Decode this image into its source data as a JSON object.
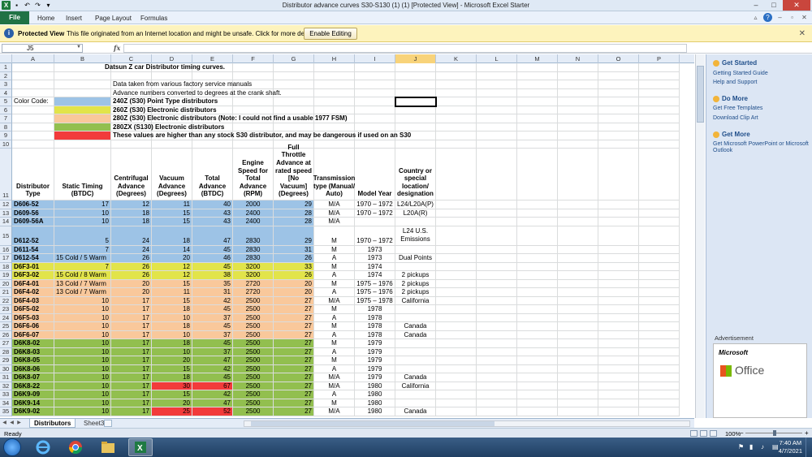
{
  "window": {
    "title": "Distributor advance curves S30-S130 (1) (1)  [Protected View] - Microsoft Excel Starter"
  },
  "ribbon": {
    "tabs": [
      "File",
      "Home",
      "Insert",
      "Page Layout",
      "Formulas"
    ]
  },
  "protected_view": {
    "label": "Protected View",
    "message": "This file originated from an Internet location and might be unsafe. Click for more details.",
    "button": "Enable Editing"
  },
  "formula_bar": {
    "name_box": "J5",
    "fx": "fx",
    "value": ""
  },
  "columns": [
    "A",
    "B",
    "C",
    "D",
    "E",
    "F",
    "G",
    "H",
    "I",
    "J",
    "K",
    "L",
    "M",
    "N",
    "O",
    "P"
  ],
  "selected_column": "J",
  "colors": {
    "blue": "#9dc3e6",
    "yellow": "#e2e44a",
    "peach": "#f9c89b",
    "green": "#92bf4f",
    "red": "#f23b3b"
  },
  "sheet": {
    "title": "Datsun Z car Distributor timing curves.",
    "note1": "Data taken from various factory service manuals",
    "note2": "Advance numbers converted to degrees at the crank shaft.",
    "color_code_label": "Color Code:",
    "legend": [
      {
        "color": "blue",
        "text": "240Z (S30) Point Type distributors"
      },
      {
        "color": "yellow",
        "text": "260Z (S30) Electronic distributors"
      },
      {
        "color": "peach",
        "text": "280Z (S30) Electronic distributors (Note: I could not find a usable 1977 FSM)"
      },
      {
        "color": "green",
        "text": "280ZX (S130) Electronic distributors"
      },
      {
        "color": "red",
        "text": "These values are higher than any stock S30 distributor, and may be dangerous if used on an S30"
      }
    ],
    "headers": [
      "Distributor Type",
      "Static Timing (BTDC)",
      "Centrifugal Advance (Degrees)",
      "Vacuum Advance (Degrees)",
      "Total Advance (BTDC)",
      "Engine Speed for Total Advance (RPM)",
      "Full Throttle Advance at rated speed [No Vacuum](Degrees)",
      "Transmission type (Manual/ Auto)",
      "Model Year",
      "Country or special location/ designation"
    ],
    "rows": [
      {
        "n": "12",
        "c": "blue",
        "a": "D606-52",
        "b": "17",
        "cc": "12",
        "d": "11",
        "e": "40",
        "f": "2000",
        "g": "29",
        "h": "M/A",
        "i": "1970 – 1972",
        "j": "L24/L20A(P)"
      },
      {
        "n": "13",
        "c": "blue",
        "a": "D609-56",
        "b": "10",
        "cc": "18",
        "d": "15",
        "e": "43",
        "f": "2400",
        "g": "28",
        "h": "M/A",
        "i": "1970 – 1972",
        "j": "L20A(R)"
      },
      {
        "n": "14",
        "c": "blue",
        "a": "D609-56A",
        "b": "10",
        "cc": "18",
        "d": "15",
        "e": "43",
        "f": "2400",
        "g": "28",
        "h": "M/A",
        "i": "",
        "j": ""
      },
      {
        "n": "15",
        "c": "blue",
        "a": "D612-52",
        "b": "5",
        "cc": "24",
        "d": "18",
        "e": "47",
        "f": "2830",
        "g": "29",
        "h": "M",
        "i": "1970 – 1972",
        "j": "L24 U.S. Emissions"
      },
      {
        "n": "16",
        "c": "blue",
        "a": "D611-54",
        "b": "7",
        "cc": "24",
        "d": "14",
        "e": "45",
        "f": "2830",
        "g": "31",
        "h": "M",
        "i": "1973",
        "j": ""
      },
      {
        "n": "17",
        "c": "blue",
        "a": "D612-54",
        "b": "15 Cold / 5 Warm",
        "cc": "26",
        "d": "20",
        "e": "46",
        "f": "2830",
        "g": "26",
        "h": "A",
        "i": "1973",
        "j": "Dual Points"
      },
      {
        "n": "18",
        "c": "yellow",
        "a": "D6F3-01",
        "b": "7",
        "cc": "26",
        "d": "12",
        "e": "45",
        "f": "3200",
        "g": "33",
        "h": "M",
        "i": "1974",
        "j": ""
      },
      {
        "n": "19",
        "c": "yellow",
        "a": "D6F3-02",
        "b": "15 Cold / 8 Warm",
        "cc": "26",
        "d": "12",
        "e": "38",
        "f": "3200",
        "g": "26",
        "h": "A",
        "i": "1974",
        "j": "2 pickups"
      },
      {
        "n": "20",
        "c": "peach",
        "a": "D6F4-01",
        "b": "13 Cold / 7 Warm",
        "cc": "20",
        "d": "15",
        "e": "35",
        "f": "2720",
        "g": "20",
        "h": "M",
        "i": "1975 – 1976",
        "j": "2 pickups"
      },
      {
        "n": "21",
        "c": "peach",
        "a": "D6F4-02",
        "b": "13 Cold / 7 Warm",
        "cc": "20",
        "d": "11",
        "e": "31",
        "f": "2720",
        "g": "20",
        "h": "A",
        "i": "1975 – 1976",
        "j": "2 pickups"
      },
      {
        "n": "22",
        "c": "peach",
        "a": "D6F4-03",
        "b": "10",
        "cc": "17",
        "d": "15",
        "e": "42",
        "f": "2500",
        "g": "27",
        "h": "M/A",
        "i": "1975 – 1978",
        "j": "California"
      },
      {
        "n": "23",
        "c": "peach",
        "a": "D6F5-02",
        "b": "10",
        "cc": "17",
        "d": "18",
        "e": "45",
        "f": "2500",
        "g": "27",
        "h": "M",
        "i": "1978",
        "j": ""
      },
      {
        "n": "24",
        "c": "peach",
        "a": "D6F5-03",
        "b": "10",
        "cc": "17",
        "d": "10",
        "e": "37",
        "f": "2500",
        "g": "27",
        "h": "A",
        "i": "1978",
        "j": ""
      },
      {
        "n": "25",
        "c": "peach",
        "a": "D6F6-06",
        "b": "10",
        "cc": "17",
        "d": "18",
        "e": "45",
        "f": "2500",
        "g": "27",
        "h": "M",
        "i": "1978",
        "j": "Canada"
      },
      {
        "n": "26",
        "c": "peach",
        "a": "D6F6-07",
        "b": "10",
        "cc": "17",
        "d": "10",
        "e": "37",
        "f": "2500",
        "g": "27",
        "h": "A",
        "i": "1978",
        "j": "Canada"
      },
      {
        "n": "27",
        "c": "green",
        "a": "D6K8-02",
        "b": "10",
        "cc": "17",
        "d": "18",
        "e": "45",
        "f": "2500",
        "g": "27",
        "h": "M",
        "i": "1979",
        "j": ""
      },
      {
        "n": "28",
        "c": "green",
        "a": "D6K8-03",
        "b": "10",
        "cc": "17",
        "d": "10",
        "e": "37",
        "f": "2500",
        "g": "27",
        "h": "A",
        "i": "1979",
        "j": ""
      },
      {
        "n": "29",
        "c": "green",
        "a": "D6K8-05",
        "b": "10",
        "cc": "17",
        "d": "20",
        "e": "47",
        "f": "2500",
        "g": "27",
        "h": "M",
        "i": "1979",
        "j": ""
      },
      {
        "n": "30",
        "c": "green",
        "a": "D6K8-06",
        "b": "10",
        "cc": "17",
        "d": "15",
        "e": "42",
        "f": "2500",
        "g": "27",
        "h": "A",
        "i": "1979",
        "j": ""
      },
      {
        "n": "31",
        "c": "green",
        "a": "D6K8-07",
        "b": "10",
        "cc": "17",
        "d": "18",
        "e": "45",
        "f": "2500",
        "g": "27",
        "h": "M/A",
        "i": "1979",
        "j": "Canada"
      },
      {
        "n": "32",
        "c": "green",
        "a": "D6K8-22",
        "b": "10",
        "cc": "17",
        "d": "30",
        "e": "67",
        "f": "2500",
        "g": "27",
        "h": "M/A",
        "i": "1980",
        "j": "California",
        "red": true
      },
      {
        "n": "33",
        "c": "green",
        "a": "D6K9-09",
        "b": "10",
        "cc": "17",
        "d": "15",
        "e": "42",
        "f": "2500",
        "g": "27",
        "h": "A",
        "i": "1980",
        "j": ""
      },
      {
        "n": "34",
        "c": "green",
        "a": "D6K9-14",
        "b": "10",
        "cc": "17",
        "d": "20",
        "e": "47",
        "f": "2500",
        "g": "27",
        "h": "M",
        "i": "1980",
        "j": ""
      },
      {
        "n": "35",
        "c": "green",
        "a": "D6K9-02",
        "b": "10",
        "cc": "17",
        "d": "25",
        "e": "52",
        "f": "2500",
        "g": "27",
        "h": "M/A",
        "i": "1980",
        "j": "Canada",
        "red": true
      }
    ]
  },
  "sheet_tabs": [
    "Distributors",
    "Sheet3"
  ],
  "task_pane": {
    "get_started": "Get Started",
    "getting_started_guide": "Getting Started Guide",
    "help_support": "Help and Support",
    "do_more": "Do More",
    "free_templates": "Get Free Templates",
    "clip_art": "Download Clip Art",
    "get_more": "Get More",
    "get_more_link": "Get Microsoft PowerPoint or Microsoft Outlook",
    "ad_label": "Advertisement",
    "ad_ms": "Microsoft",
    "ad_office": "Office"
  },
  "status": {
    "ready": "Ready",
    "zoom": "100%",
    "zoom_minus": "−",
    "zoom_plus": "+"
  },
  "taskbar": {
    "time": "7:40 AM",
    "date": "4/7/2021"
  }
}
